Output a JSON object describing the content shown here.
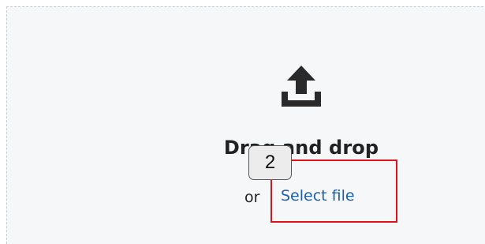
{
  "dropzone": {
    "icon": "upload-icon",
    "title": "Drag and drop",
    "or_text": "or",
    "select_link_label": "Select file"
  },
  "overlay": {
    "marker_label": "2",
    "highlight_color": "#e0121a"
  },
  "colors": {
    "link": "#1f5fa6",
    "text": "#222222",
    "dropzone_bg": "#f6f7f8"
  }
}
